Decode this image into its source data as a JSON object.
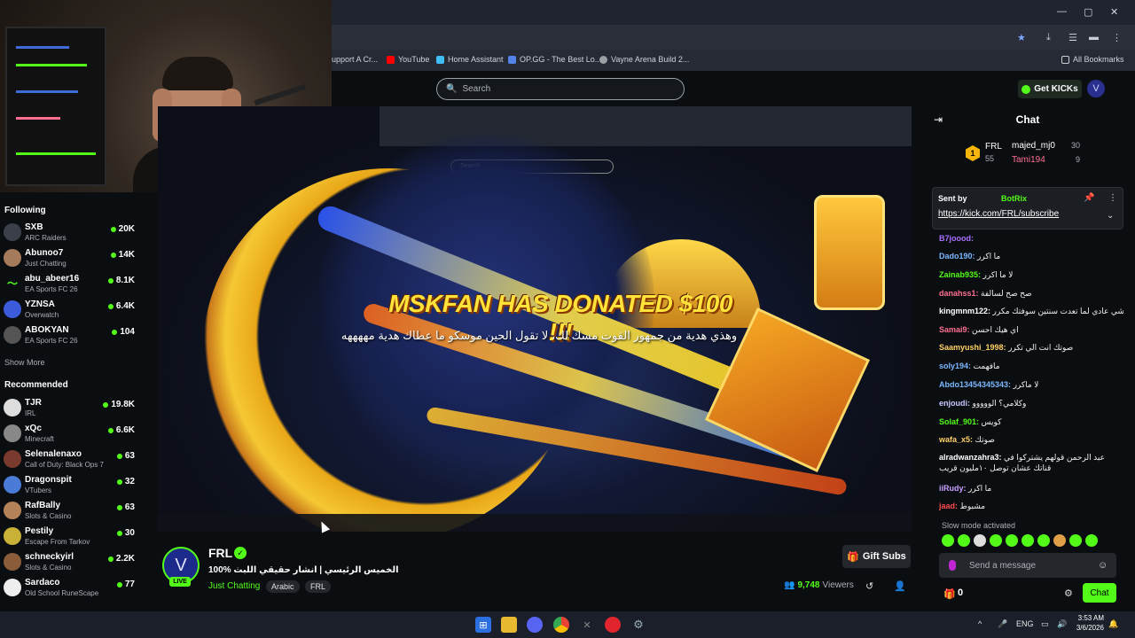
{
  "browser": {
    "bookmarks": [
      {
        "label": "upport A Cr...",
        "icon": "bookmark-icon"
      },
      {
        "label": "YouTube",
        "icon": "youtube-icon"
      },
      {
        "label": "Home Assistant",
        "icon": "home-icon"
      },
      {
        "label": "OP.GG - The Best Lo...",
        "icon": "opgg-icon"
      },
      {
        "label": "Vayne Arena Build 2...",
        "icon": "globe-icon"
      }
    ],
    "all_bookmarks": "All Bookmarks"
  },
  "topnav": {
    "search_placeholder": "Search",
    "get_kicks": "Get KICKs"
  },
  "sidebar": {
    "following_title": "Following",
    "following": [
      {
        "name": "SXB",
        "category": "ARC Raiders",
        "viewers": "20K",
        "color": "#3a3f4a"
      },
      {
        "name": "Abunoo7",
        "category": "Just Chatting",
        "viewers": "14K",
        "color": "#a67b5b"
      },
      {
        "name": "abu_abeer16",
        "category": "EA Sports FC 26",
        "viewers": "8.1K",
        "color": "#1a6b2c"
      },
      {
        "name": "YZNSA",
        "category": "Overwatch",
        "viewers": "6.4K",
        "color": "#3b5bdb"
      },
      {
        "name": "ABOKYAN",
        "category": "EA Sports FC 26",
        "viewers": "104",
        "color": "#555"
      }
    ],
    "show_more": "Show More",
    "recommended_title": "Recommended",
    "recommended": [
      {
        "name": "TJR",
        "category": "IRL",
        "viewers": "19.8K",
        "color": "#ddd"
      },
      {
        "name": "xQc",
        "category": "Minecraft",
        "viewers": "6.6K",
        "color": "#888"
      },
      {
        "name": "Selenalenaxo",
        "category": "Call of Duty: Black Ops 7",
        "viewers": "63",
        "color": "#7a3b2e"
      },
      {
        "name": "Dragonspit",
        "category": "VTubers",
        "viewers": "32",
        "color": "#4a7bd6"
      },
      {
        "name": "RafBally",
        "category": "Slots & Casino",
        "viewers": "63",
        "color": "#b5835a"
      },
      {
        "name": "Pestily",
        "category": "Escape From Tarkov",
        "viewers": "30",
        "color": "#c9b037"
      },
      {
        "name": "schneckyirl",
        "category": "Slots & Casino",
        "viewers": "2.2K",
        "color": "#8a5c3a"
      },
      {
        "name": "Sardaco",
        "category": "Old School RuneScape",
        "viewers": "77",
        "color": "#eee"
      }
    ]
  },
  "video": {
    "donation_text": "MSKFAN HAS DONATED $100 !!!",
    "donation_message": "وهذي هدية من جمهور القوت مسك لك، لا تقول الحين موسكو ما عطاك هدية مههههه"
  },
  "stream": {
    "channel": "FRL",
    "live": "LIVE",
    "title": "100% الخميس الرئيسي | انشار حقيقي اللبث",
    "category": "Just Chatting",
    "tags": [
      "Arabic",
      "FRL"
    ],
    "gift_subs": "Gift Subs",
    "viewers": "9,748",
    "viewers_label": "Viewers"
  },
  "chat": {
    "title": "Chat",
    "leaderboard": {
      "rank": "1",
      "channel": "FRL",
      "channel_count": "55",
      "users": [
        {
          "name": "majed_mj0",
          "count": "30"
        },
        {
          "name": "Tami194",
          "count": "9"
        }
      ]
    },
    "pinned": {
      "sent_by": "Sent by",
      "bot": "BotRix",
      "link": "https://kick.com/FRL/subscribe"
    },
    "messages": [
      {
        "user": "B7joood:",
        "text": "",
        "color": "#a970ff"
      },
      {
        "user": "Dado190:",
        "text": "ما اكرر",
        "color": "#7bb7ff"
      },
      {
        "user": "Zainab935:",
        "text": "لا ما اكرر",
        "color": "#53fc18"
      },
      {
        "user": "danahss1:",
        "text": "صح صح لسالفة",
        "color": "#ff6f91"
      },
      {
        "user": "kingmnm122:",
        "text": "ماكان فيه شي عادي لما تعدت سنتين سوفتك مكرر",
        "color": "#ffffff"
      },
      {
        "user": "Samai9:",
        "text": "اي هيك احسن",
        "color": "#ff6f91"
      },
      {
        "user": "Saamyushi_1998:",
        "text": "صوتك انت الي تكرر",
        "color": "#ffd166"
      },
      {
        "user": "soly194:",
        "text": "مافهمت",
        "color": "#7bb7ff"
      },
      {
        "user": "Abdo13454345343:",
        "text": "لا ماكرر",
        "color": "#7bb7ff"
      },
      {
        "user": "enjoudi:",
        "text": "وكلامي؟ الووووو",
        "color": "#c9c9ff"
      },
      {
        "user": "Solaf_901:",
        "text": "كويس",
        "color": "#53fc18"
      },
      {
        "user": "wafa_x5:",
        "text": "صوتك",
        "color": "#ffd166"
      },
      {
        "user": "alradwanzahra3:",
        "text": "عبد الرحمن قولهم يشتركوا في قناتك عشان توصل ١٠مليون قريب",
        "color": "#ffffff"
      },
      {
        "user": "iiRudy:",
        "text": "ما اكرر",
        "color": "#c9a0ff"
      },
      {
        "user": "jaad:",
        "text": "مشبوط",
        "color": "#ff4b4b"
      }
    ],
    "slow_mode": "Slow mode activated",
    "input_placeholder": "Send a message",
    "gift_count": "0",
    "chat_button": "Chat"
  },
  "taskbar": {
    "lang": "ENG",
    "time": "3:53 AM",
    "date": "3/6/2026"
  },
  "colors": {
    "accent": "#53fc18",
    "background": "#0b0e11"
  }
}
